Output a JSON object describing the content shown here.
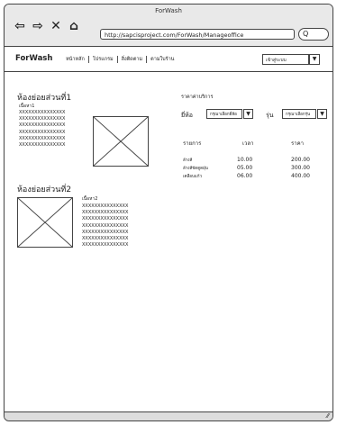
{
  "window": {
    "title": "ForWash"
  },
  "toolbar": {
    "back_icon": "⇦",
    "forward_icon": "⇨",
    "close_icon": "✕",
    "home_icon": "⌂",
    "url": "http://sapcisproject.com/ForWash/Manageoffice",
    "search_icon": "Q"
  },
  "menubar": {
    "brand": "ForWash",
    "items": [
      "หน้าหลัก",
      "โปรแกรม",
      "สิ่งติดตาม",
      "ตามใบร้าน"
    ],
    "account": "เข้าสู่ระบบ",
    "account_arrow": "▼"
  },
  "section1": {
    "title": "ห้องย่อยส่วนที่1",
    "subtitle": "เนื้อหา1",
    "lines": [
      "XXXXXXXXXXXXXXX",
      "XXXXXXXXXXXXXXX",
      "XXXXXXXXXXXXXXX",
      "XXXXXXXXXXXXXXX",
      "XXXXXXXXXXXXXXX",
      "XXXXXXXXXXXXXXX"
    ]
  },
  "section2": {
    "title": "ห้องย่อยส่วนที่2",
    "subtitle": "เนื้อหา2",
    "lines": [
      "XXXXXXXXXXXXXXX",
      "XXXXXXXXXXXXXXX",
      "XXXXXXXXXXXXXXX",
      "XXXXXXXXXXXXXXX",
      "XXXXXXXXXXXXXXX",
      "XXXXXXXXXXXXXXX",
      "XXXXXXXXXXXXXXX"
    ]
  },
  "pricing": {
    "title": "ราคาค่าบริการ",
    "brand_label": "ยี่ห้อ",
    "brand_select": "กรุณาเลือกยี่ห้อ",
    "model_label": "รุ่น",
    "model_select": "กรุณาเลือกรุ่น",
    "arrow": "▼",
    "headers": [
      "รายการ",
      "เวลา",
      "ราคา"
    ],
    "rows": [
      [
        "ล้างสี",
        "10.00",
        "200.00"
      ],
      [
        "ล้างสีขัดดูดฝุ่น",
        "05.00",
        "300.00"
      ],
      [
        "เคลือบแก้ว",
        "06.00",
        "400.00"
      ]
    ]
  },
  "status": {
    "grip": "⁄⁄"
  }
}
